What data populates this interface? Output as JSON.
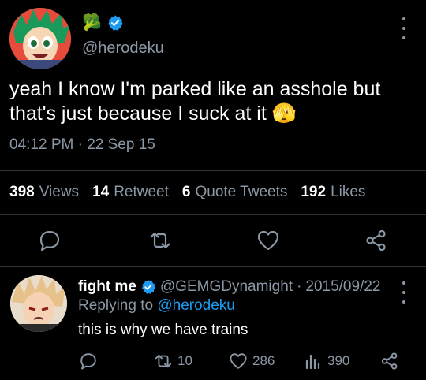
{
  "tweet": {
    "name_emoji": "🥦",
    "handle": "@herodeku",
    "text": "yeah I know I'm parked like an asshole but that's just because I suck at it",
    "text_emoji": "🫣",
    "timestamp": "04:12 PM · 22 Sep 15",
    "stats": [
      {
        "count": "398",
        "label": "Views"
      },
      {
        "count": "14",
        "label": "Retweet"
      },
      {
        "count": "6",
        "label": "Quote Tweets"
      },
      {
        "count": "192",
        "label": "Likes"
      }
    ],
    "actions": [
      "reply-icon",
      "retweet-icon",
      "like-icon",
      "share-icon"
    ]
  },
  "reply": {
    "name": "fight me",
    "handle": "@GEMGDynamight",
    "date": "2015/09/22",
    "replying_prefix": "Replying to",
    "replying_handle": "@herodeku",
    "text": "this is why we have trains",
    "retweets": "10",
    "likes": "286",
    "views": "390"
  },
  "colors": {
    "background": "#000000",
    "muted": "#8b98a5",
    "accent": "#1d9bf0",
    "divider": "#2f3336"
  }
}
